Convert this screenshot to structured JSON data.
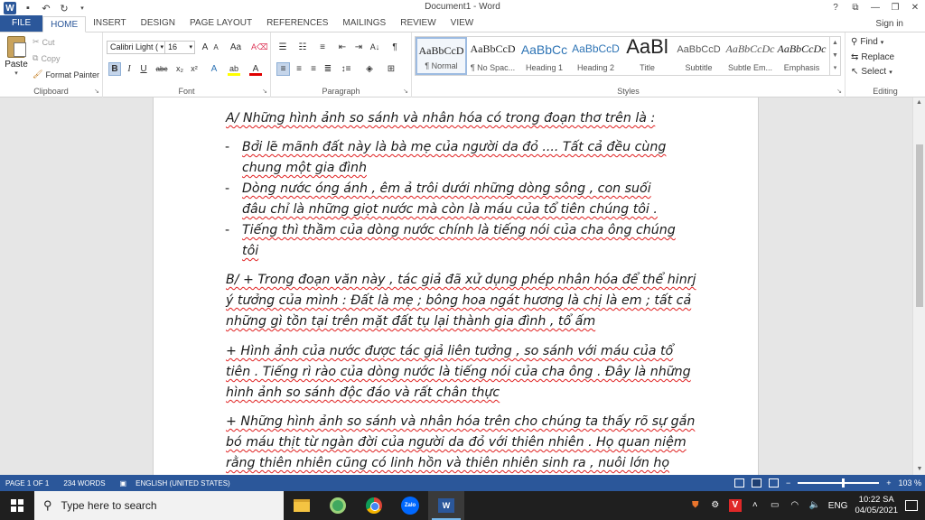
{
  "window": {
    "title": "Document1 - Word",
    "controls": [
      "?",
      "⧉",
      "—",
      "❐",
      "✕"
    ]
  },
  "qat": {
    "app_icon": "W",
    "save_icon": "save-icon",
    "undo_icon": "undo-icon",
    "redo_icon": "redo-icon"
  },
  "tabs": [
    "FILE",
    "HOME",
    "INSERT",
    "DESIGN",
    "PAGE LAYOUT",
    "REFERENCES",
    "MAILINGS",
    "REVIEW",
    "VIEW"
  ],
  "signin": "Sign in",
  "clipboard": {
    "paste": "Paste",
    "cut": "Cut",
    "copy": "Copy",
    "format_painter": "Format Painter",
    "label": "Clipboard"
  },
  "font": {
    "name": "Calibri Light (",
    "size": "16",
    "label": "Font",
    "grow": "A",
    "shrink": "A",
    "case": "Aa",
    "bold": "B",
    "italic": "I",
    "underline": "U",
    "strike": "abc",
    "sub": "x₂",
    "sup": "x²",
    "effects": "A",
    "highlight": "ab",
    "color": "A"
  },
  "paragraph": {
    "label": "Paragraph",
    "pilcrow": "¶",
    "sort": "A↓"
  },
  "styles": {
    "label": "Styles",
    "items": [
      {
        "sample": "AaBbCcD",
        "name": "¶ Normal"
      },
      {
        "sample": "AaBbCcD",
        "name": "¶ No Spac..."
      },
      {
        "sample": "AaBbCc",
        "name": "Heading 1"
      },
      {
        "sample": "AaBbCcD",
        "name": "Heading 2"
      },
      {
        "sample": "AaBl",
        "name": "Title"
      },
      {
        "sample": "AaBbCcD",
        "name": "Subtitle"
      },
      {
        "sample": "AaBbCcDc",
        "name": "Subtle Em..."
      },
      {
        "sample": "AaBbCcDc",
        "name": "Emphasis"
      }
    ]
  },
  "editing": {
    "find": "Find",
    "replace": "Replace",
    "select": "Select",
    "label": "Editing"
  },
  "document": {
    "para_a": [
      "A/ Những hình ảnh so sánh và nhân hóa có trong đoạn thơ trên là :"
    ],
    "bullets": [
      [
        "Bởi lẽ mãnh đất này là bà mẹ của người da đỏ .... Tất cả đều cùng",
        "chung một gia đình"
      ],
      [
        "Dòng nước óng ánh , êm ả trôi dưới những dòng sông , con suối",
        "đâu chỉ là những giọt nước mà còn là máu của tổ tiên chúng tôi ."
      ],
      [
        "Tiếng thì thầm của dòng nước chính là tiếng nói của cha ông chúng",
        "tôi"
      ]
    ],
    "para_b": [
      "B/ + Trong đoạn văn này , tác giả đã xử dụng phép nhân hóa để thể hinrj",
      "ý tưởng của mình : Đất là mẹ ; bông hoa ngát hương là chị là em ; tất cả",
      "những gì tồn tại trên mặt đất tụ lại thành gia đình , tổ ấm"
    ],
    "para_c": [
      "+ Hình ảnh của nước được tác giả liên tưởng , so sánh với máu của tổ",
      "tiên . Tiếng rì rào của dòng nước là tiếng nói của cha ông . Đây là những",
      "hình ảnh so sánh độc đáo và rất chân thực"
    ],
    "para_d": [
      "+ Những hình ảnh so sánh và nhân hóa trên cho chúng ta thấy rõ sự gắn",
      "bó máu thịt từ ngàn đời của người da đỏ với thiên nhiên . Họ quan niệm",
      "rằng thiên nhiên cũng có linh hồn và thiên nhiên sinh ra , nuôi lớn họ"
    ]
  },
  "status": {
    "page": "PAGE 1 OF 1",
    "words": "234 WORDS",
    "language": "ENGLISH (UNITED STATES)",
    "zoom": "103 %",
    "zoom_minus": "−",
    "zoom_plus": "+"
  },
  "taskbar": {
    "search_placeholder": "Type here to search",
    "zalo": "Zalo",
    "word": "W",
    "tray_lang": "ENG",
    "time": "10:22 SA",
    "date": "04/05/2021"
  }
}
